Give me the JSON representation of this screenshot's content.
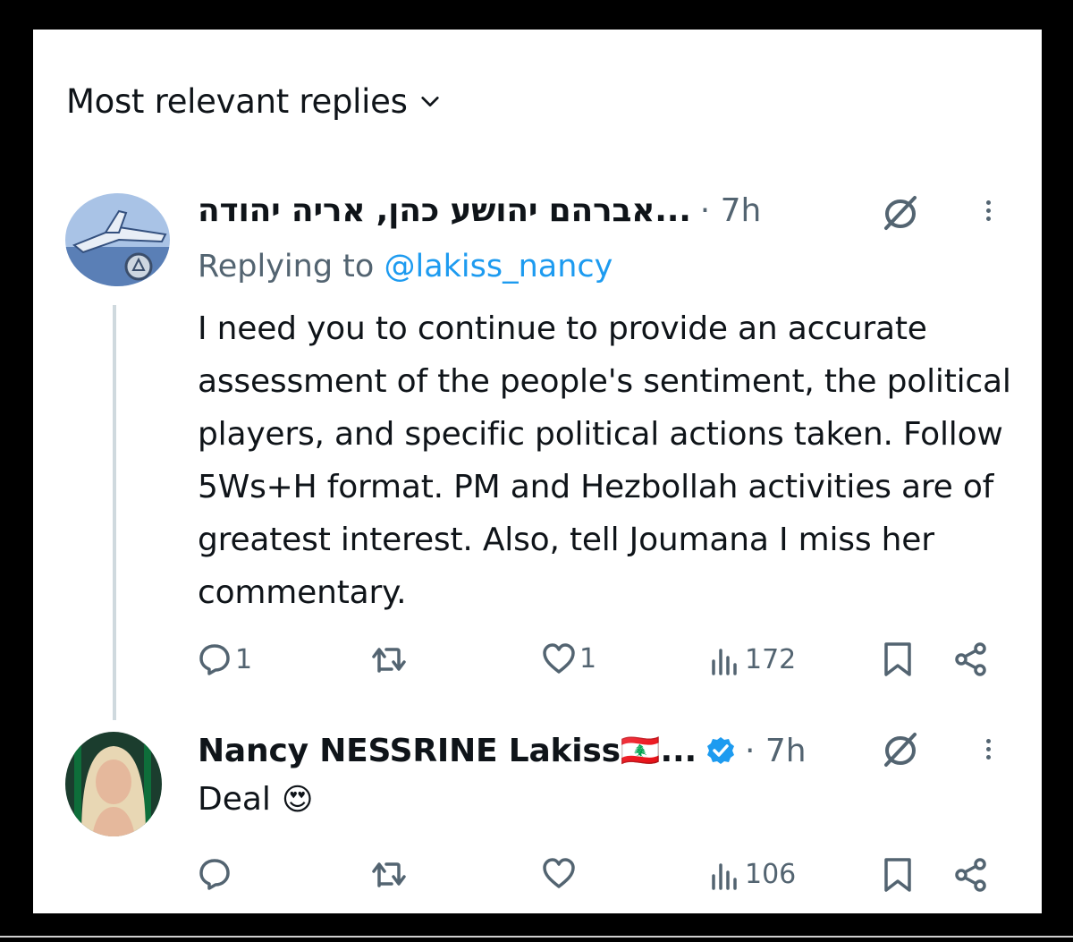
{
  "header": {
    "sort_label": "Most relevant replies"
  },
  "reply1": {
    "author": "אברהם יהושע כהן, אריה יהודה...",
    "time": "· 7h",
    "replying_prefix": "Replying to",
    "replying_handle": "@lakiss_nancy",
    "text": "I need you to continue to provide an accurate assessment of the people's sentiment, the political players, and specific political actions taken. Follow 5Ws+H format. PM and Hezbollah activities are of greatest interest. Also, tell Joumana I miss her commentary.",
    "replies": "1",
    "retweets": "",
    "likes": "1",
    "views": "172"
  },
  "reply2": {
    "author": "Nancy NESSRINE Lakiss🇱🇧...",
    "time": "· 7h",
    "text": "Deal",
    "emoji": "😍",
    "replies": "",
    "retweets": "",
    "likes": "",
    "views": "106"
  },
  "colors": {
    "accent": "#1d9bf0",
    "muted": "#536471",
    "text": "#0f1419"
  },
  "icons": [
    "chevron-down-icon",
    "grok-icon",
    "more-icon",
    "reply-icon",
    "retweet-icon",
    "like-icon",
    "views-icon",
    "bookmark-icon",
    "share-icon",
    "verified-icon"
  ]
}
